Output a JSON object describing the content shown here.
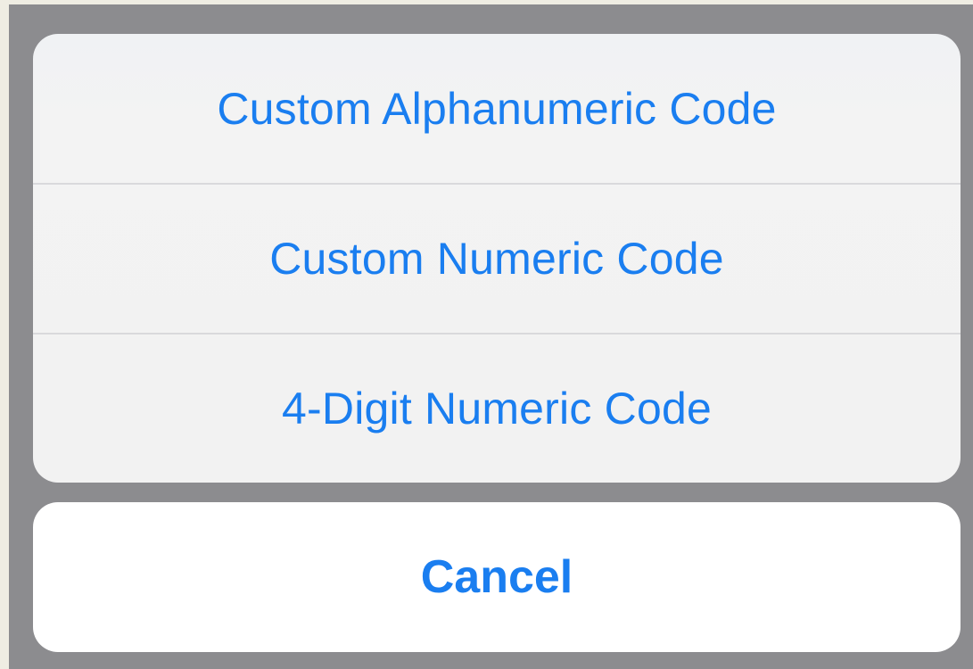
{
  "action_sheet": {
    "options": [
      {
        "label": "Custom Alphanumeric Code"
      },
      {
        "label": "Custom Numeric Code"
      },
      {
        "label": "4-Digit Numeric Code"
      }
    ],
    "cancel_label": "Cancel"
  },
  "colors": {
    "accent": "#1a7ef0",
    "backdrop": "#8c8c8f",
    "sheet_background": "#f2f2f2",
    "cancel_background": "#ffffff",
    "separator": "#d9d9dc"
  }
}
